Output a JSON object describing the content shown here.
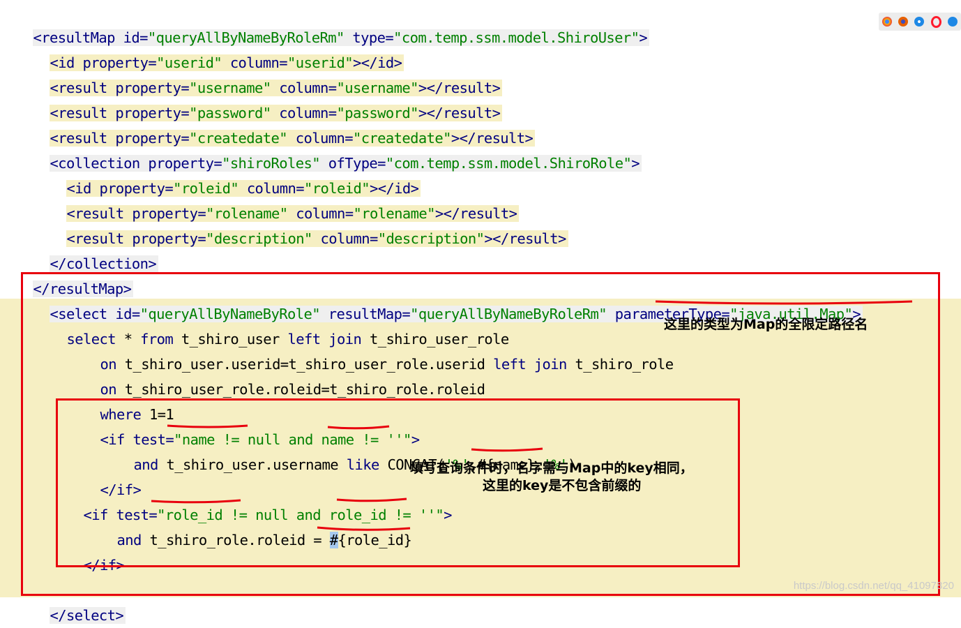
{
  "browser_icons": [
    "chrome-icon",
    "firefox-icon",
    "safari-icon",
    "opera-icon",
    "edge-icon"
  ],
  "code": {
    "l1": {
      "a": "<resultMap id=",
      "b": "\"queryAllByNameByRoleRm\"",
      "c": " type=",
      "d": "\"com.temp.ssm.model.ShiroUser\"",
      "e": ">"
    },
    "l2": {
      "a": "<id property=",
      "b": "\"userid\"",
      "c": " column=",
      "d": "\"userid\"",
      "e": "></id>"
    },
    "l3": {
      "a": "<result property=",
      "b": "\"username\"",
      "c": " column=",
      "d": "\"username\"",
      "e": "></result>"
    },
    "l4": {
      "a": "<result property=",
      "b": "\"password\"",
      "c": " column=",
      "d": "\"password\"",
      "e": "></result>"
    },
    "l5": {
      "a": "<result property=",
      "b": "\"createdate\"",
      "c": " column=",
      "d": "\"createdate\"",
      "e": "></result>"
    },
    "l6": {
      "a": "<collection property=",
      "b": "\"shiroRoles\"",
      "c": " ofType=",
      "d": "\"com.temp.ssm.model.ShiroRole\"",
      "e": ">"
    },
    "l7": {
      "a": "<id property=",
      "b": "\"roleid\"",
      "c": " column=",
      "d": "\"roleid\"",
      "e": "></id>"
    },
    "l8": {
      "a": "<result property=",
      "b": "\"rolename\"",
      "c": " column=",
      "d": "\"rolename\"",
      "e": "></result>"
    },
    "l9": {
      "a": "<result property=",
      "b": "\"description\"",
      "c": " column=",
      "d": "\"description\"",
      "e": "></result>"
    },
    "l10": "</collection>",
    "l11": "</resultMap>",
    "l12": {
      "a": "<select id=",
      "b": "\"queryAllByNameByRole\"",
      "c": " resultMap=",
      "d": "\"queryAllByNameByRoleRm\"",
      "e": " parameterType=",
      "f": "\"java.util.Map\"",
      "g": ">"
    },
    "l13": {
      "a": "select ",
      "b": "* ",
      "c": "from",
      "d": " t_shiro_user ",
      "e": "left join",
      "f": " t_shiro_user_role"
    },
    "l14": {
      "a": "on",
      "b": " t_shiro_user.userid=t_shiro_user_role.userid ",
      "c": "left join",
      "d": " t_shiro_role"
    },
    "l15": {
      "a": "on",
      "b": " t_shiro_user_role.roleid=t_shiro_role.roleid"
    },
    "l16": {
      "a": "where",
      "b": " 1=1"
    },
    "l17": {
      "a": "<if test=",
      "b": "\"name != null and name != ''\"",
      "c": ">"
    },
    "l18": {
      "a": "and",
      "b": " t_shiro_user.username ",
      "c": "like",
      "d": " CONCAT(",
      "e": "'%'",
      "f": ",#{name},",
      "g": "'%'",
      "h": ")"
    },
    "l19": "</if>",
    "l20": {
      "a": "<if test=",
      "b": "\"role_id != null and role_id != ''\"",
      "c": ">"
    },
    "l21": {
      "a": "and",
      "b": " t_shiro_role.roleid = ",
      "c": "#",
      "d": "{role_id}"
    },
    "l22": "</if>",
    "l23": "</select>"
  },
  "annotations": {
    "note1": "这里的类型为Map的全限定路径名",
    "note2_line1": "填写查询条件时，名字需与Map中的key相同，",
    "note2_line2": "这里的key是不包含前缀的"
  },
  "watermark": "https://blog.csdn.net/qq_41097820"
}
